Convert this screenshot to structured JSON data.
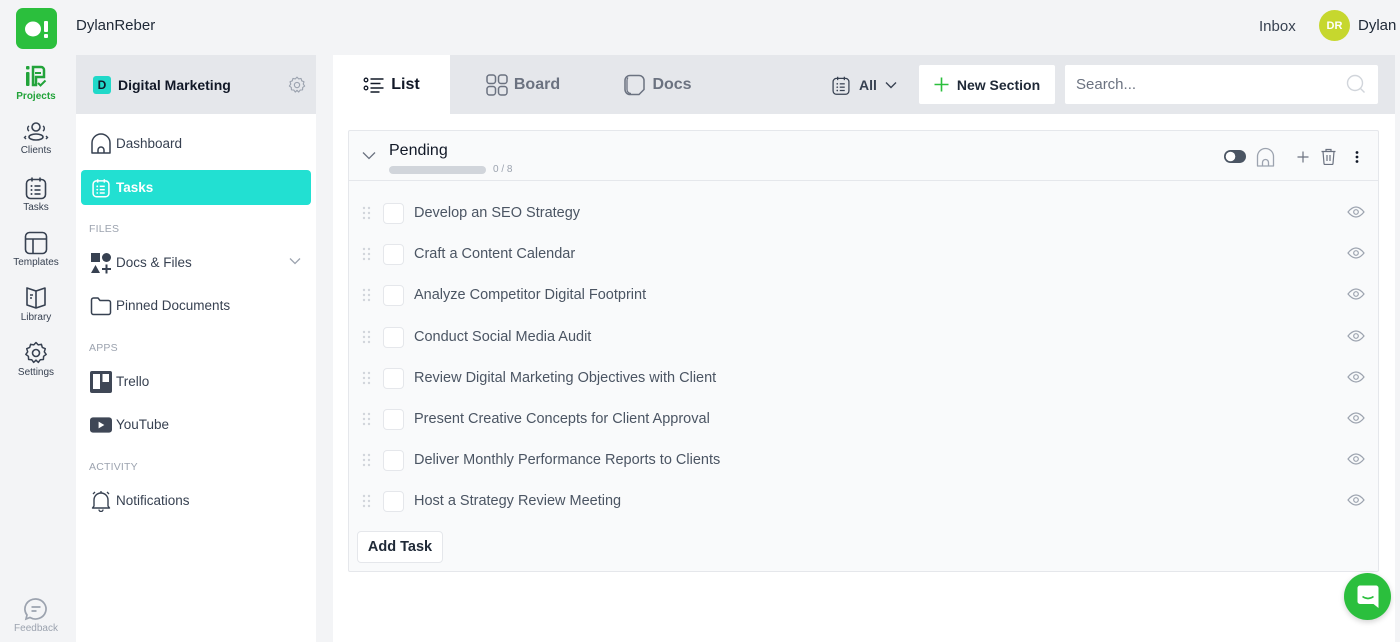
{
  "app": {
    "workspace_name": "DylanReber",
    "brand_color": "#2bbf3d",
    "accent_color": "#22e0d2"
  },
  "topbar": {
    "inbox_label": "Inbox",
    "user_initials": "DR",
    "user_name": "Dylan",
    "avatar_color": "#c6d72e"
  },
  "rail": {
    "items": [
      {
        "label": "Projects",
        "icon": "projects-icon",
        "active": true
      },
      {
        "label": "Clients",
        "icon": "clients-icon",
        "active": false
      },
      {
        "label": "Tasks",
        "icon": "tasks-icon",
        "active": false
      },
      {
        "label": "Templates",
        "icon": "templates-icon",
        "active": false
      },
      {
        "label": "Library",
        "icon": "library-icon",
        "active": false
      },
      {
        "label": "Settings",
        "icon": "settings-icon",
        "active": false
      }
    ],
    "feedback_label": "Feedback"
  },
  "sidebar": {
    "project_initial": "D",
    "project_name": "Digital Marketing",
    "nav": [
      {
        "label": "Dashboard",
        "icon": "home-icon",
        "active": false
      },
      {
        "label": "Tasks",
        "icon": "tasks-icon",
        "active": true
      }
    ],
    "files_label": "FILES",
    "files": [
      {
        "label": "Docs & Files",
        "icon": "shapes-icon",
        "expandable": true
      },
      {
        "label": "Pinned Documents",
        "icon": "folder-icon"
      }
    ],
    "apps_label": "APPS",
    "apps": [
      {
        "label": "Trello",
        "icon": "trello-icon"
      },
      {
        "label": "YouTube",
        "icon": "youtube-icon"
      }
    ],
    "activity_label": "ACTIVITY",
    "activity": [
      {
        "label": "Notifications",
        "icon": "bell-icon"
      }
    ]
  },
  "main": {
    "tabs": [
      {
        "label": "List",
        "icon": "list-icon",
        "active": true
      },
      {
        "label": "Board",
        "icon": "board-icon",
        "active": false
      },
      {
        "label": "Docs",
        "icon": "docs-icon",
        "active": false
      }
    ],
    "filter_value": "All",
    "new_section_label": "New Section",
    "search_placeholder": "Search...",
    "search_value": "",
    "section": {
      "title": "Pending",
      "completed": 0,
      "total": 8,
      "progress_text": "0 / 8",
      "progress_fraction": 0,
      "toggle_on": false,
      "tasks": [
        {
          "title": "Develop an SEO Strategy",
          "done": false
        },
        {
          "title": "Craft a Content Calendar",
          "done": false
        },
        {
          "title": "Analyze Competitor Digital Footprint",
          "done": false
        },
        {
          "title": "Conduct Social Media Audit",
          "done": false
        },
        {
          "title": "Review Digital Marketing Objectives with Client",
          "done": false
        },
        {
          "title": "Present Creative Concepts for Client Approval",
          "done": false
        },
        {
          "title": "Deliver Monthly Performance Reports to Clients",
          "done": false
        },
        {
          "title": "Host a Strategy Review Meeting",
          "done": false
        }
      ],
      "add_task_label": "Add Task"
    }
  }
}
